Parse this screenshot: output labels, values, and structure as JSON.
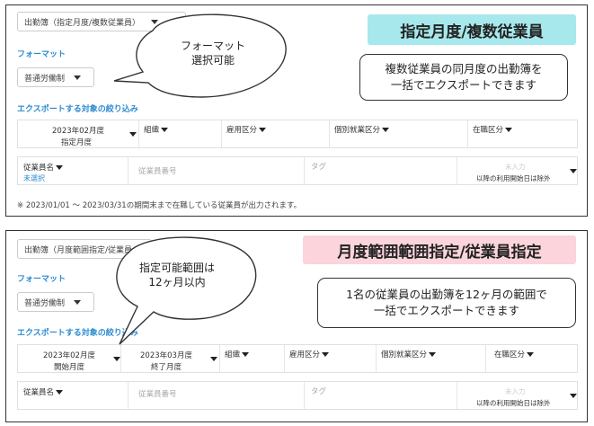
{
  "panel1": {
    "report_select": "出勤簿（指定月度/複数従業員）",
    "format_label": "フォーマット",
    "format_value": "普通労働制",
    "filter_label": "エクスポートする対象の絞り込み",
    "month": {
      "value": "2023年02月度",
      "sub": "指定月度"
    },
    "org_label": "組織",
    "employment_label": "雇用区分",
    "individual_label": "個別就業区分",
    "status_label": "在職区分",
    "employee_name_label": "従業員名",
    "employee_name_value": "未選択",
    "employee_no_placeholder": "従業員番号",
    "tag_placeholder": "タグ",
    "not_entered": "未入力",
    "exclude_text": "以降の利用開始日は除外",
    "note": "※ 2023/01/01 〜 2023/03/31の期間末まで在職している従業員が出力されます。",
    "banner": "指定月度/複数従業員",
    "bubble": [
      "フォーマット",
      "選択可能"
    ],
    "desc": [
      "複数従業員の同月度の出勤簿を",
      "一括でエクスポートできます"
    ]
  },
  "panel2": {
    "report_select": "出勤簿（月度範囲指定/従業員",
    "format_label": "フォーマット",
    "format_value": "普通労働制",
    "filter_label": "エクスポートする対象の絞り込み",
    "month_start": {
      "value": "2023年02月度",
      "sub": "開始月度"
    },
    "month_end": {
      "value": "2023年03月度",
      "sub": "終了月度"
    },
    "org_label": "組織",
    "employment_label": "雇用区分",
    "individual_label": "個別就業区分",
    "status_label": "在職区分",
    "employee_name_label": "従業員名",
    "employee_no_placeholder": "従業員番号",
    "tag_placeholder": "タグ",
    "not_entered": "未入力",
    "exclude_text": "以降の利用開始日は除外",
    "banner": "月度範囲範囲指定/従業員指定",
    "bubble": [
      "指定可能範囲は",
      "12ヶ月以内"
    ],
    "desc": [
      "1名の従業員の出勤簿を12ヶ月の範囲で",
      "一括でエクスポートできます"
    ]
  }
}
